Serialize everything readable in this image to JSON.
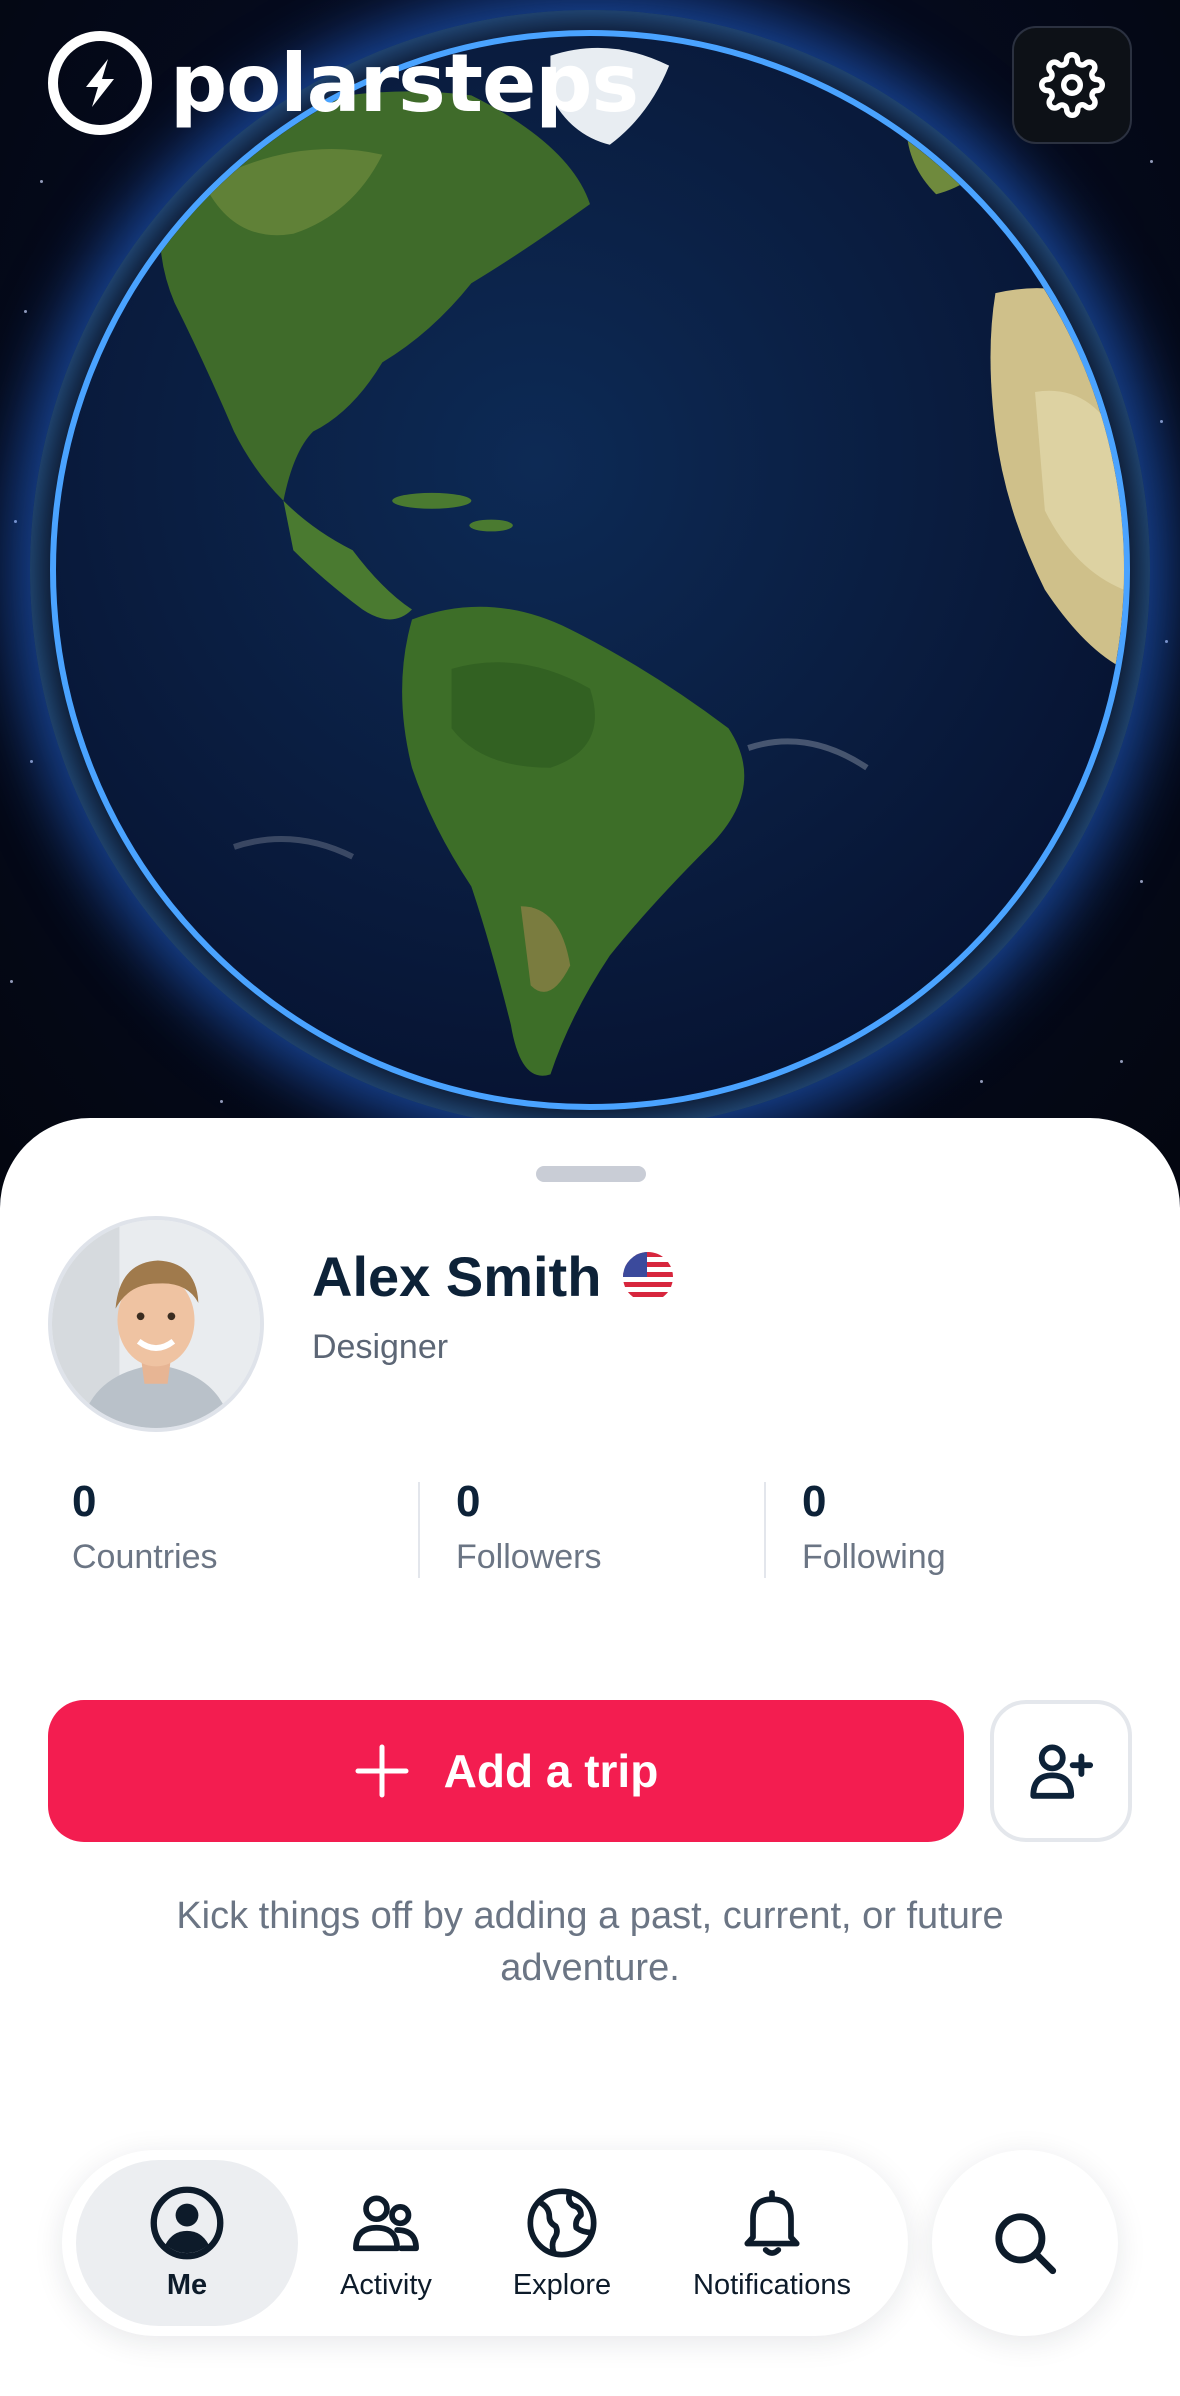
{
  "app": {
    "logo_text": "polarsteps"
  },
  "header": {
    "settings_icon": "gear-icon"
  },
  "profile": {
    "name": "Alex Smith",
    "flag": "us-flag",
    "role": "Designer"
  },
  "stats": [
    {
      "value": "0",
      "label": "Countries"
    },
    {
      "value": "0",
      "label": "Followers"
    },
    {
      "value": "0",
      "label": "Following"
    }
  ],
  "actions": {
    "add_trip_label": "Add a trip",
    "add_friend_icon": "add-user-icon",
    "hint": "Kick things off by adding a past, current, or future adventure."
  },
  "nav": {
    "items": [
      {
        "label": "Me",
        "icon": "person-circle-icon",
        "active": true
      },
      {
        "label": "Activity",
        "icon": "people-icon",
        "active": false
      },
      {
        "label": "Explore",
        "icon": "globe-icon",
        "active": false
      },
      {
        "label": "Notifications",
        "icon": "bell-icon",
        "active": false
      }
    ],
    "search_icon": "search-icon"
  },
  "colors": {
    "accent": "#f31d50",
    "text_dark": "#0d2238",
    "text_muted": "#6b7584",
    "space": "#050a1c"
  }
}
